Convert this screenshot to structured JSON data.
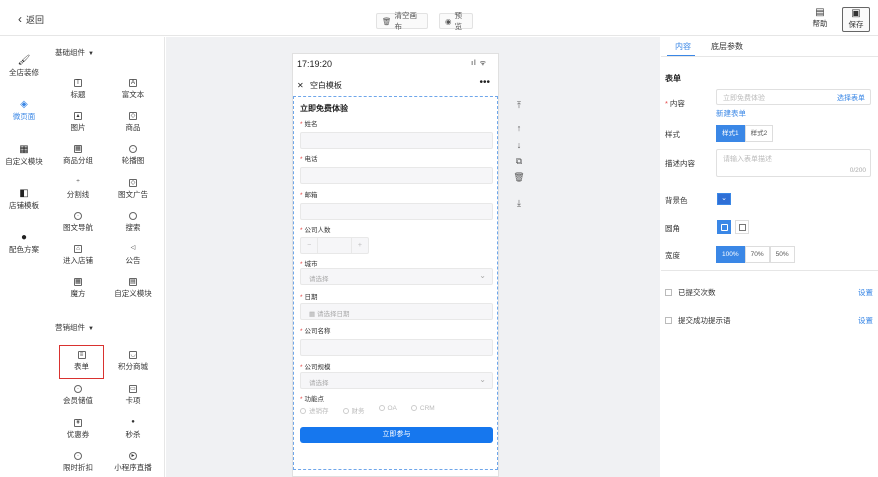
{
  "topbar": {
    "back_label": "返回",
    "clear_label": "清空画布",
    "preview_label": "预览",
    "help_label": "帮助",
    "save_label": "保存"
  },
  "leftnav": [
    {
      "label": "全店装修",
      "icon": "brush-icon",
      "active": false
    },
    {
      "label": "微页面",
      "icon": "layers-icon",
      "active": true
    },
    {
      "label": "自定义模块",
      "icon": "module-icon",
      "active": false
    },
    {
      "label": "店铺模板",
      "icon": "template-icon",
      "active": false
    },
    {
      "label": "配色方案",
      "icon": "palette-icon",
      "active": false
    }
  ],
  "components": {
    "basic_title": "基础组件",
    "basic": [
      "标题",
      "富文本",
      "图片",
      "商品",
      "商品分组",
      "轮播图",
      "分割线",
      "图文广告",
      "图文导航",
      "搜索",
      "进入店铺",
      "公告",
      "魔方",
      "自定义模块"
    ],
    "marketing_title": "营销组件",
    "marketing": [
      "表单",
      "积分商城",
      "会员储值",
      "卡项",
      "优惠券",
      "秒杀",
      "限时折扣",
      "小程序直播"
    ]
  },
  "phone": {
    "time": "17:19:20",
    "signal": "ıl ᯤ",
    "nav_title": "空白模板",
    "form_title": "立即免费体验",
    "fields": {
      "name": "姓名",
      "phone": "电话",
      "email": "邮箱",
      "people": "公司人数",
      "city": "城市",
      "city_placeholder": "请选择",
      "date": "日期",
      "date_placeholder": "请选择日期",
      "company": "公司名称",
      "scale": "公司规模",
      "scale_placeholder": "请选择",
      "features": "功能点",
      "options": [
        "进销存",
        "财务",
        "OA",
        "CRM"
      ]
    },
    "submit_label": "立即参与"
  },
  "rightpanel": {
    "tab_content": "内容",
    "tab_base": "底层参数",
    "section": "表单",
    "content_label": "内容",
    "content_placeholder": "立即免费体验",
    "select_form": "选择表单",
    "new_form": "新建表单",
    "style_label": "样式",
    "styles": [
      "样式1",
      "样式2"
    ],
    "desc_label": "描述内容",
    "desc_placeholder": "请输入表单描述",
    "desc_count": "0/200",
    "bg_label": "背景色",
    "bg_color": "#2f6fd6",
    "corner_label": "圆角",
    "width_label": "宽度",
    "widths": [
      "100%",
      "70%",
      "50%"
    ],
    "submit_times": "已提交次数",
    "success_tip": "提交成功提示语",
    "settings": "设置"
  }
}
